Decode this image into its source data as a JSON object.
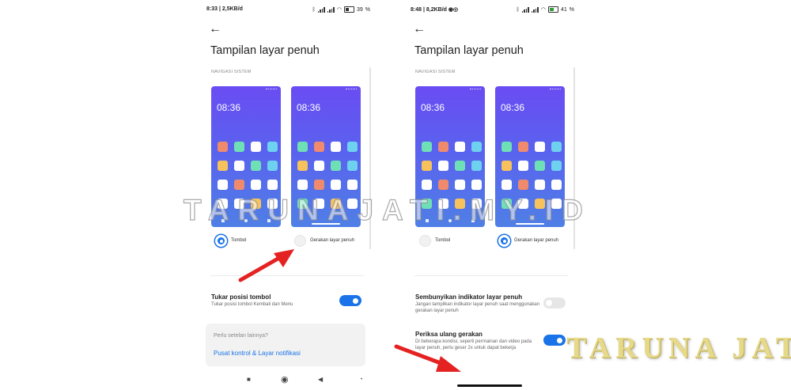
{
  "left_screen": {
    "status": {
      "time": "8:33",
      "speed": "2,5KB/d",
      "battery": "39"
    },
    "title": "Tampilan layar penuh",
    "section_label": "NAVIGASI SISTEM",
    "preview_time_a": "08:36",
    "preview_time_b": "08:36",
    "option_buttons": "Tombol",
    "option_gestures": "Gerakan layar penuh",
    "selected": "Tombol",
    "setting": {
      "title": "Tukar posisi tombol",
      "subtitle": "Tukar posisi tombol Kembali dan Menu",
      "enabled": true
    },
    "card": {
      "title": "Perlu setelan lainnya?",
      "link": "Pusat kontrol & Layar notifikasi"
    }
  },
  "right_screen": {
    "status": {
      "time": "8:48",
      "speed": "8,2KB/d",
      "battery": "41"
    },
    "title": "Tampilan layar penuh",
    "section_label": "NAVIGASI SISTEM",
    "preview_time_a": "08:36",
    "preview_time_b": "08:36",
    "option_buttons": "Tombol",
    "option_gestures": "Gerakan layar penuh",
    "selected": "Gerakan layar penuh",
    "setting_hide": {
      "title": "Sembunyikan indikator layar penuh",
      "subtitle": "Jangan tampilkan indikator layar penuh saat menggunakan gerakan layar penuh",
      "enabled": false
    },
    "setting_recheck": {
      "title": "Periksa ulang gerakan",
      "subtitle": "Di beberapa kondisi, seperti permainan dan video pada layar penuh, perlu geser 2x untuk dapat bekerja",
      "enabled": true
    }
  },
  "watermark": "TARUNAJATI.MY.ID",
  "logo": "TARUNA JATI",
  "colors": {
    "accent": "#1a73e8",
    "arrow": "#e52222",
    "preview_gradient_top": "#6a4cf3",
    "preview_gradient_bottom": "#4f7fe6"
  },
  "icons": [
    "back-arrow-icon",
    "wifi-icon",
    "signal-icon",
    "battery-icon",
    "bluetooth-icon",
    "square-nav-icon",
    "circle-nav-icon",
    "triangle-back-nav-icon"
  ]
}
